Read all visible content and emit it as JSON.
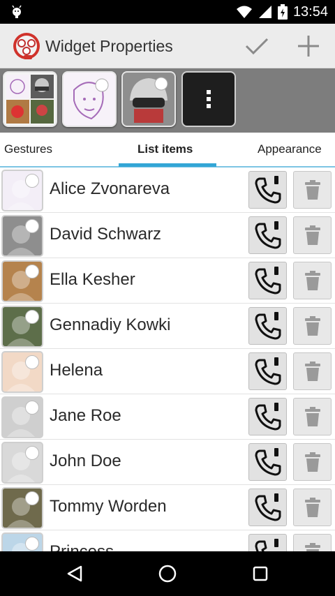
{
  "status_bar": {
    "time": "13:54",
    "icons": [
      "android-robot-icon",
      "wifi-icon",
      "cell-signal-icon",
      "battery-charging-icon"
    ]
  },
  "app_bar": {
    "title": "Widget Properties",
    "logo_icon": "app-logo-icon",
    "actions": [
      "check-icon",
      "add-icon"
    ]
  },
  "widget_strip": {
    "thumbnails": [
      "widget-grid-preview",
      "widget-single-avatar-preview",
      "widget-helmet-avatar-preview"
    ],
    "more_icon": "more-vert-icon"
  },
  "tabs": [
    {
      "label": "Gestures",
      "active": false
    },
    {
      "label": "List items",
      "active": true
    },
    {
      "label": "Appearance",
      "active": false
    }
  ],
  "contacts": [
    {
      "name": "Alice Zvonareva",
      "avatar_color": "#f3eef7"
    },
    {
      "name": "David Schwarz",
      "avatar_color": "#8e8e8e"
    },
    {
      "name": "Ella Kesher",
      "avatar_color": "#b5834d"
    },
    {
      "name": "Gennadiy Kowki",
      "avatar_color": "#5d6e4a"
    },
    {
      "name": "Helena",
      "avatar_color": "#f2d9c6"
    },
    {
      "name": "Jane Roe",
      "avatar_color": "#cfcfcf"
    },
    {
      "name": "John Doe",
      "avatar_color": "#d9d9d9"
    },
    {
      "name": "Tommy Worden",
      "avatar_color": "#6f6a4c"
    },
    {
      "name": "Princess",
      "avatar_color": "#bcd6e8"
    }
  ],
  "colors": {
    "accent": "#33a6d6",
    "tab_underline": "#7cc5e3",
    "app_bar": "#ececec",
    "strip": "#7d7d7d"
  },
  "nav_bar": {
    "icons": [
      "back-icon",
      "home-icon",
      "recents-icon"
    ]
  }
}
